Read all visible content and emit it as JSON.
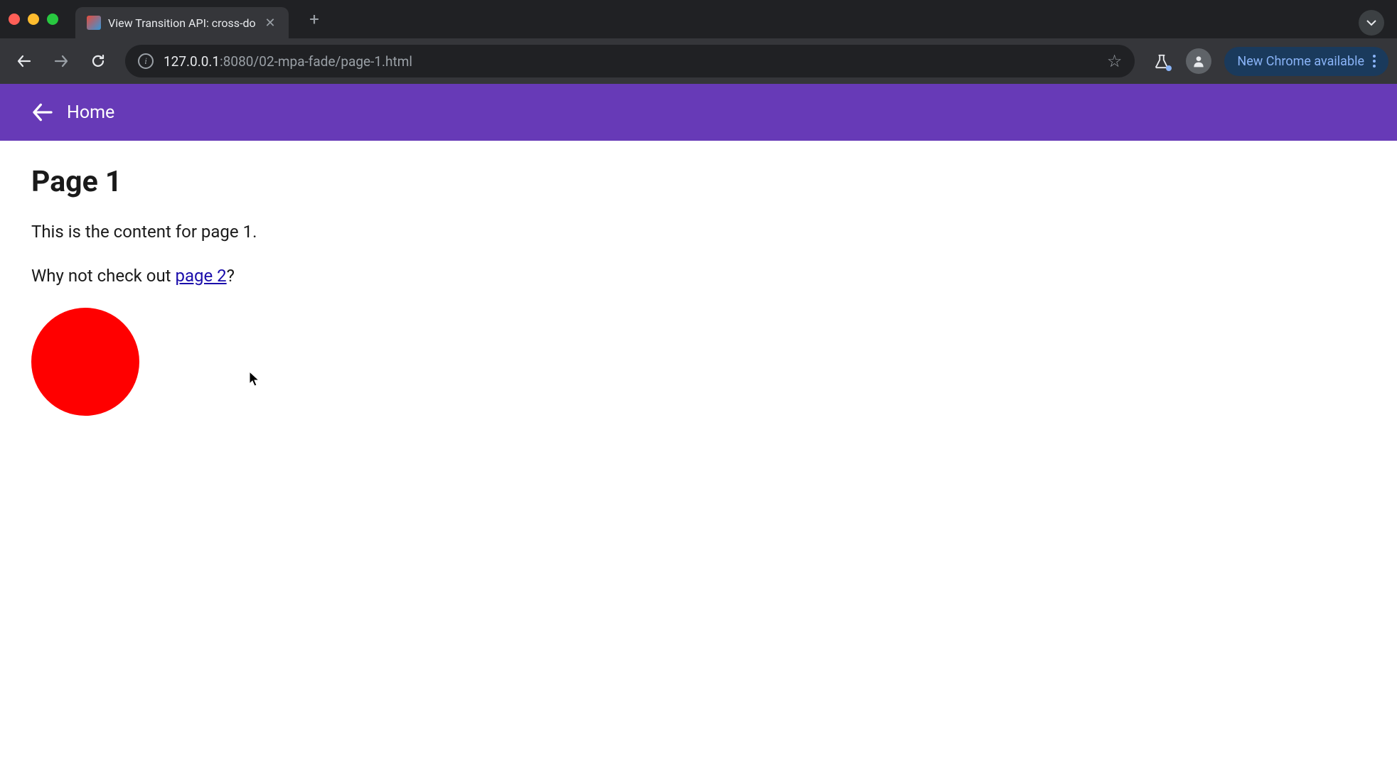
{
  "browser": {
    "tab_title": "View Transition API: cross-do",
    "url_host": "127.0.0.1",
    "url_port_path": ":8080/02-mpa-fade/page-1.html",
    "update_label": "New Chrome available"
  },
  "page": {
    "header_label": "Home",
    "title": "Page 1",
    "paragraph1": "This is the content for page 1.",
    "paragraph2_prefix": "Why not check out ",
    "paragraph2_link": "page 2",
    "paragraph2_suffix": "?"
  },
  "colors": {
    "header_bg": "#673ab7",
    "circle": "#ff0000",
    "link": "#1a0dab"
  }
}
